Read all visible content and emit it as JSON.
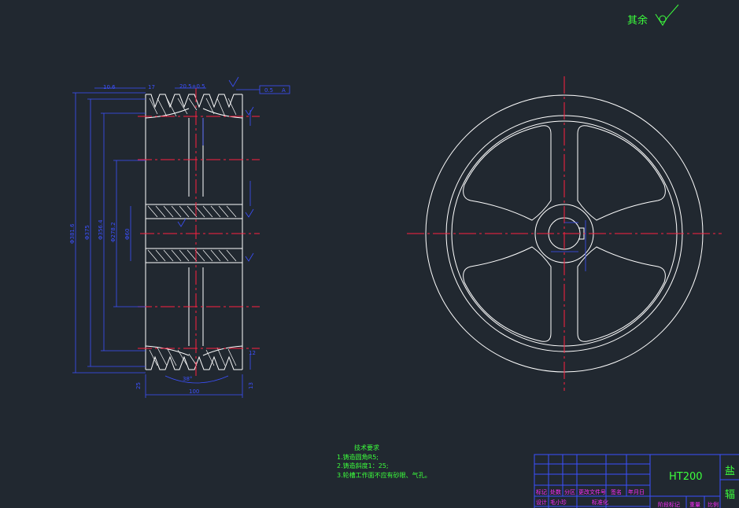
{
  "roughness_note": "其余",
  "tech_requirements": {
    "title": "技术要求",
    "items": [
      "1.铸造圆角R5;",
      "2.铸造斜度1：25;",
      "3.轮槽工作面不应有砂眼、气孔。"
    ]
  },
  "title_block": {
    "material": "HT200",
    "part_name_partial": "盐",
    "part_name_partial2": "辐",
    "row_labels": [
      "标记",
      "处数",
      "分区",
      "更改文件号",
      "签名",
      "年月日"
    ],
    "row2_labels": [
      "设计",
      "毛小珍",
      "",
      "标准化"
    ],
    "row3_labels": [
      "阶段标记",
      "重量",
      "比例"
    ]
  },
  "dimensions": {
    "top_left": "10.6",
    "top_17": "17",
    "top_pitch": "20.5±0.5",
    "tolerance_box": "0.5",
    "datum": "A",
    "d1": "Φ381.6",
    "d2": "Φ375",
    "d3": "Φ356.4",
    "d4": "Φ278.2",
    "d5": "Φ60",
    "bottom_width": "100",
    "angle": "38°",
    "right_12": "12",
    "right_13": "13",
    "right_25": "25"
  }
}
